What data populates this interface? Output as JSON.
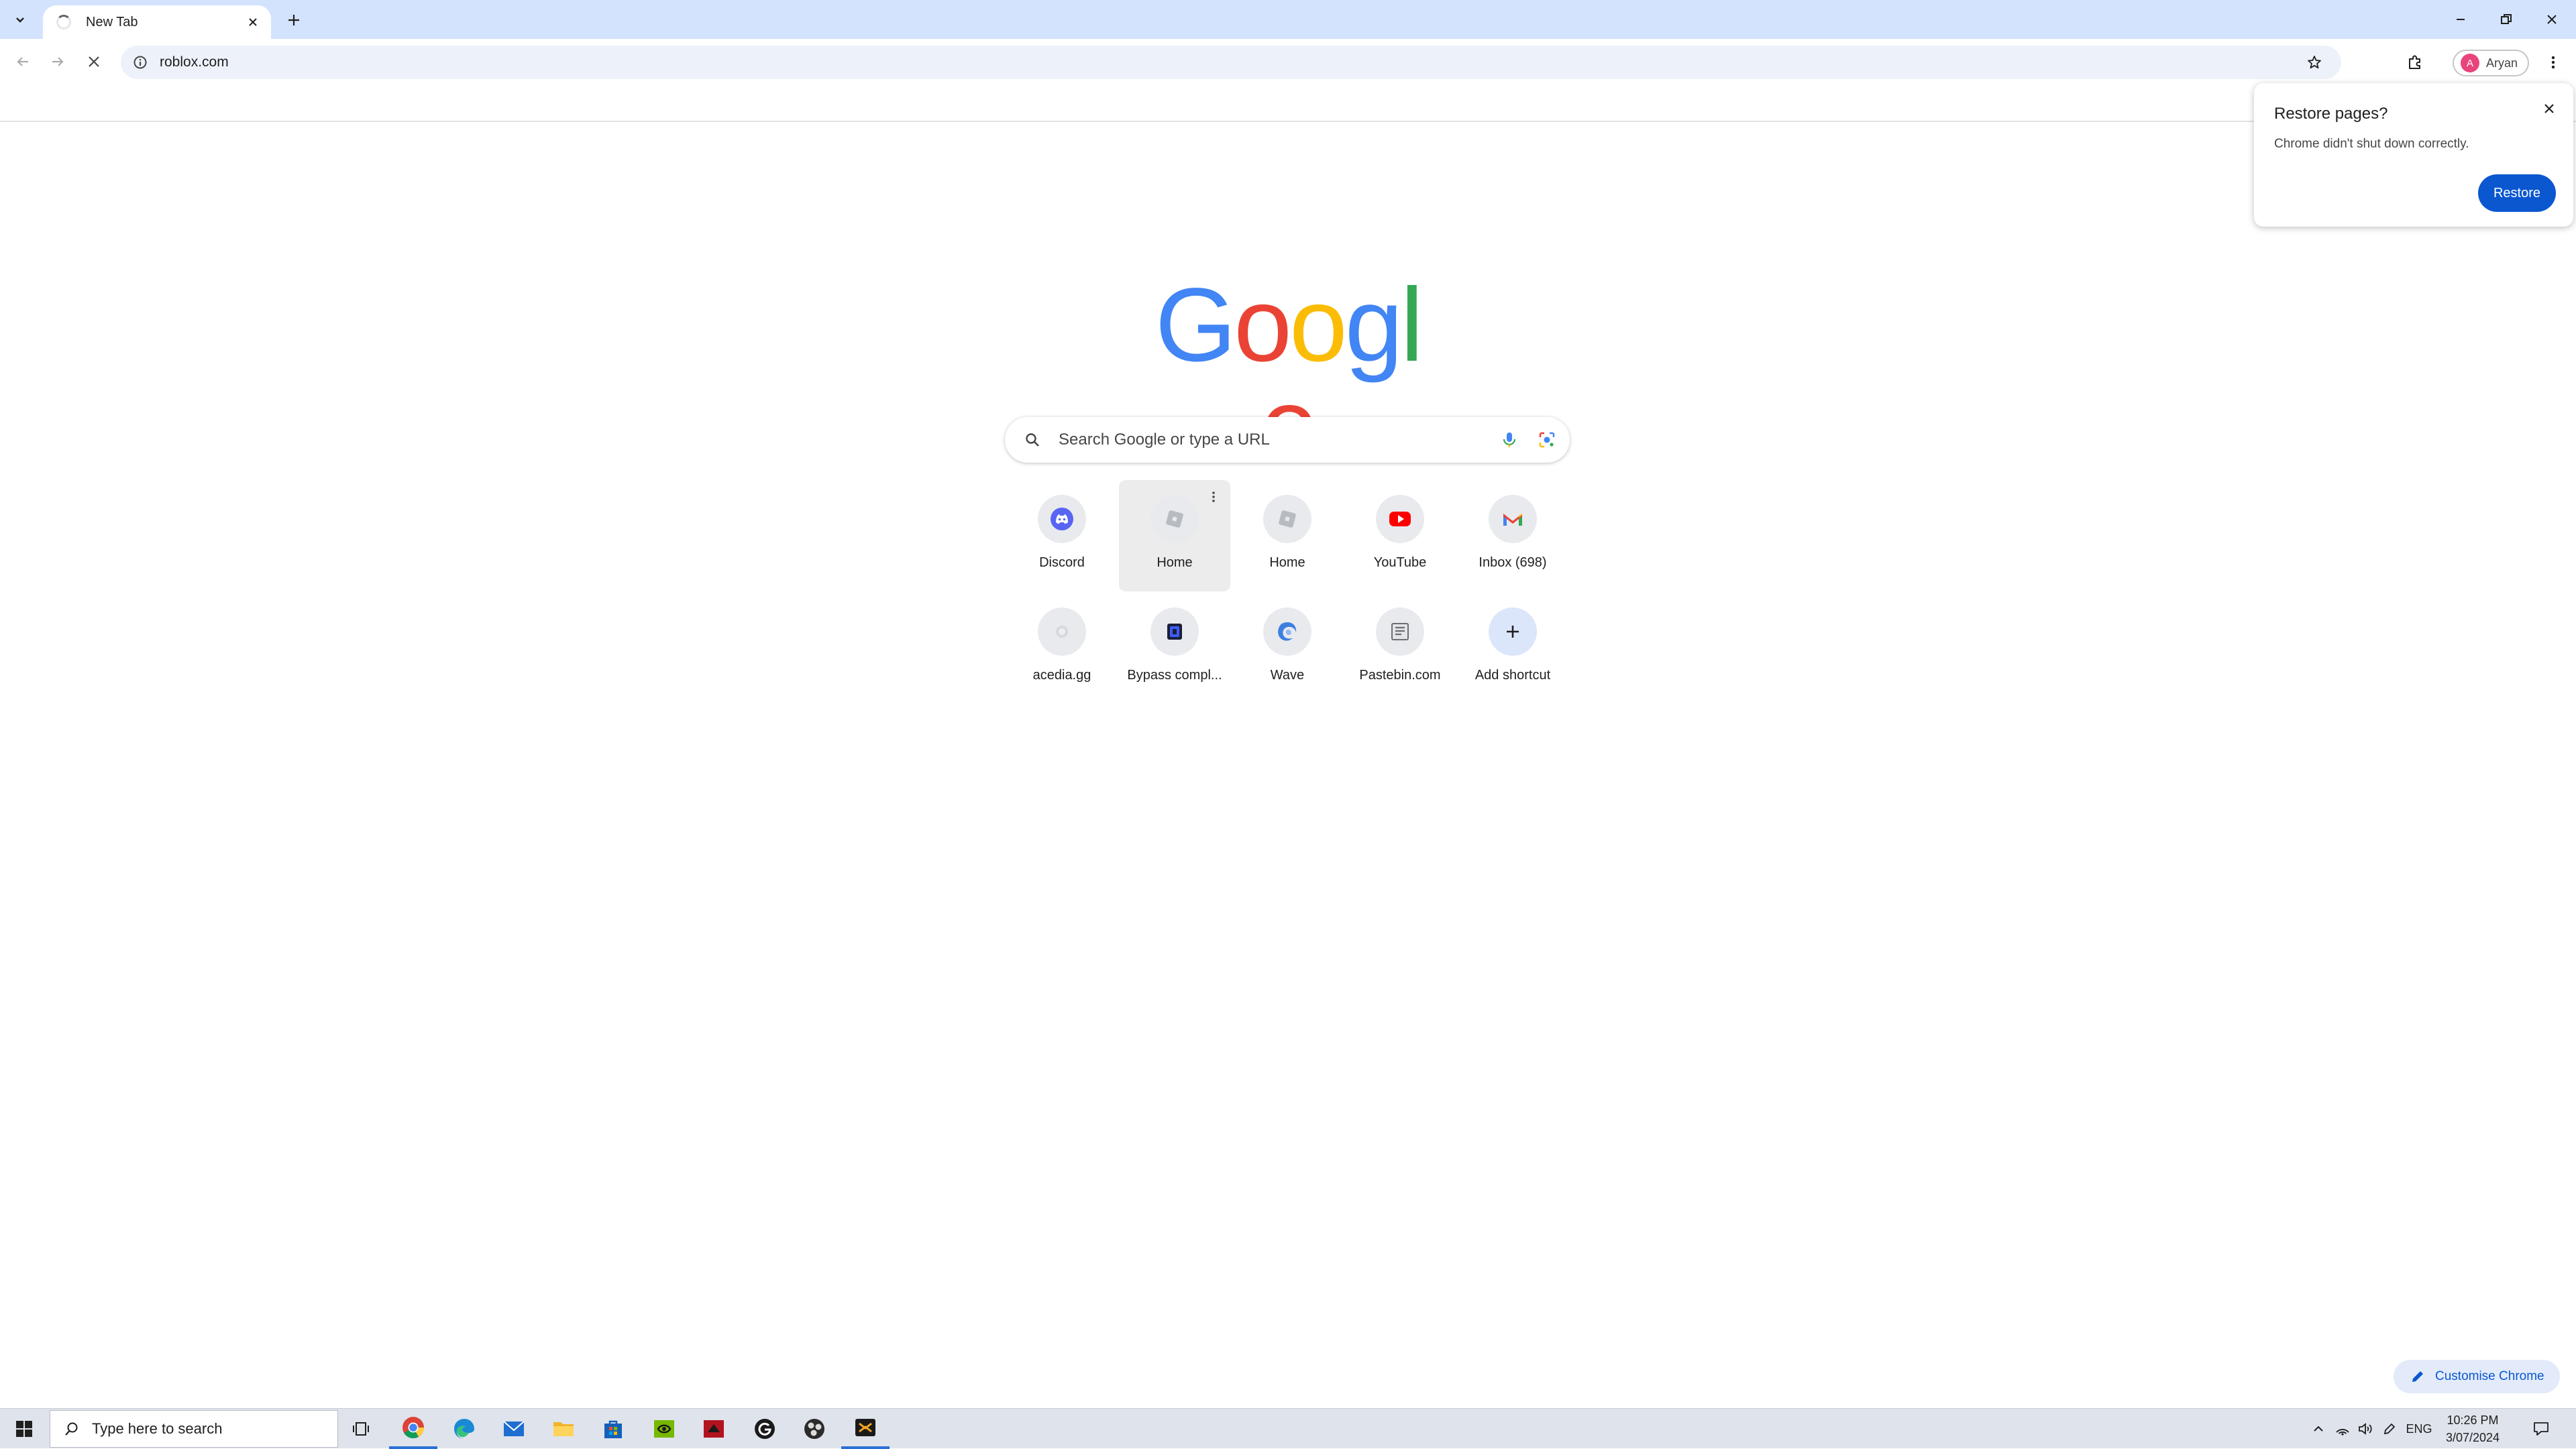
{
  "tab": {
    "title": "New Tab"
  },
  "toolbar": {
    "url": "roblox.com",
    "profile_initial": "A",
    "profile_name": "Aryan"
  },
  "logo": {
    "letters": [
      "G",
      "o",
      "o",
      "g",
      "l",
      "e"
    ],
    "colors": [
      "#4285f4",
      "#ea4335",
      "#fbbc05",
      "#4285f4",
      "#34a853",
      "#ea4335"
    ]
  },
  "search": {
    "placeholder": "Search Google or type a URL"
  },
  "shortcuts": [
    {
      "label": "Discord",
      "icon": "discord-icon"
    },
    {
      "label": "Home",
      "icon": "roblox-icon"
    },
    {
      "label": "Home",
      "icon": "roblox-icon"
    },
    {
      "label": "YouTube",
      "icon": "youtube-icon"
    },
    {
      "label": "Inbox (698)",
      "icon": "gmail-icon"
    },
    {
      "label": "acedia.gg",
      "icon": "acedia-icon"
    },
    {
      "label": "Bypass compl...",
      "icon": "bypass-icon"
    },
    {
      "label": "Wave",
      "icon": "wave-icon"
    },
    {
      "label": "Pastebin.com",
      "icon": "pastebin-icon"
    },
    {
      "label": "Add shortcut",
      "icon": "plus-icon"
    }
  ],
  "popup": {
    "title": "Restore pages?",
    "message": "Chrome didn't shut down correctly.",
    "button": "Restore"
  },
  "customise": {
    "label": "Customise Chrome"
  },
  "taskbar": {
    "search_placeholder": "Type here to search",
    "language": "ENG",
    "time": "10:26 PM",
    "date": "3/07/2024"
  },
  "colors": {
    "accent": "#0b57d0",
    "tabstrip": "#d3e3fd",
    "omnibox": "#edf2fa"
  }
}
